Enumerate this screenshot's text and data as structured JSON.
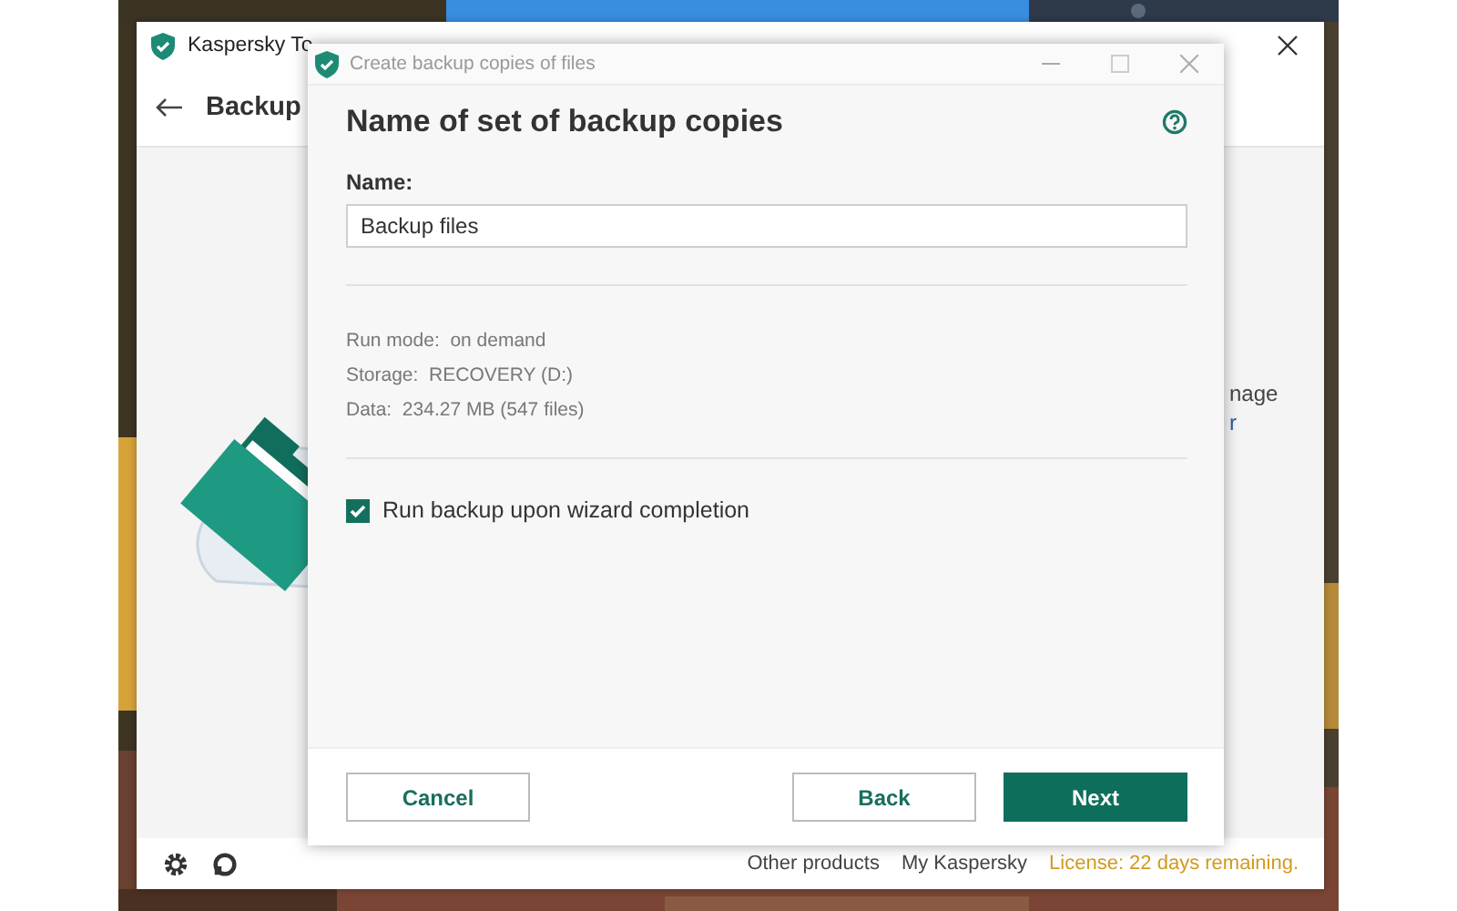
{
  "main_window": {
    "title": "Kaspersky To",
    "heading": "Backup",
    "side_text": [
      "nage",
      "r"
    ],
    "footer_links": [
      "Other products",
      "My Kaspersky"
    ],
    "license": "License: 22 days remaining."
  },
  "dialog": {
    "title": "Create backup copies of files",
    "heading": "Name of set of backup copies",
    "name_label": "Name:",
    "name_value": "Backup files",
    "details": [
      {
        "label": "Run mode:",
        "value": "on demand"
      },
      {
        "label": "Storage:",
        "value": "RECOVERY (D:)"
      },
      {
        "label": "Data:",
        "value": "234.27 MB (547 files)"
      }
    ],
    "run_backup": {
      "label": "Run backup upon wizard completion",
      "checked": true
    },
    "buttons": [
      {
        "label": "Cancel",
        "kind": "secondary"
      },
      {
        "label": "Back",
        "kind": "secondary"
      },
      {
        "label": "Next",
        "kind": "primary"
      }
    ]
  }
}
